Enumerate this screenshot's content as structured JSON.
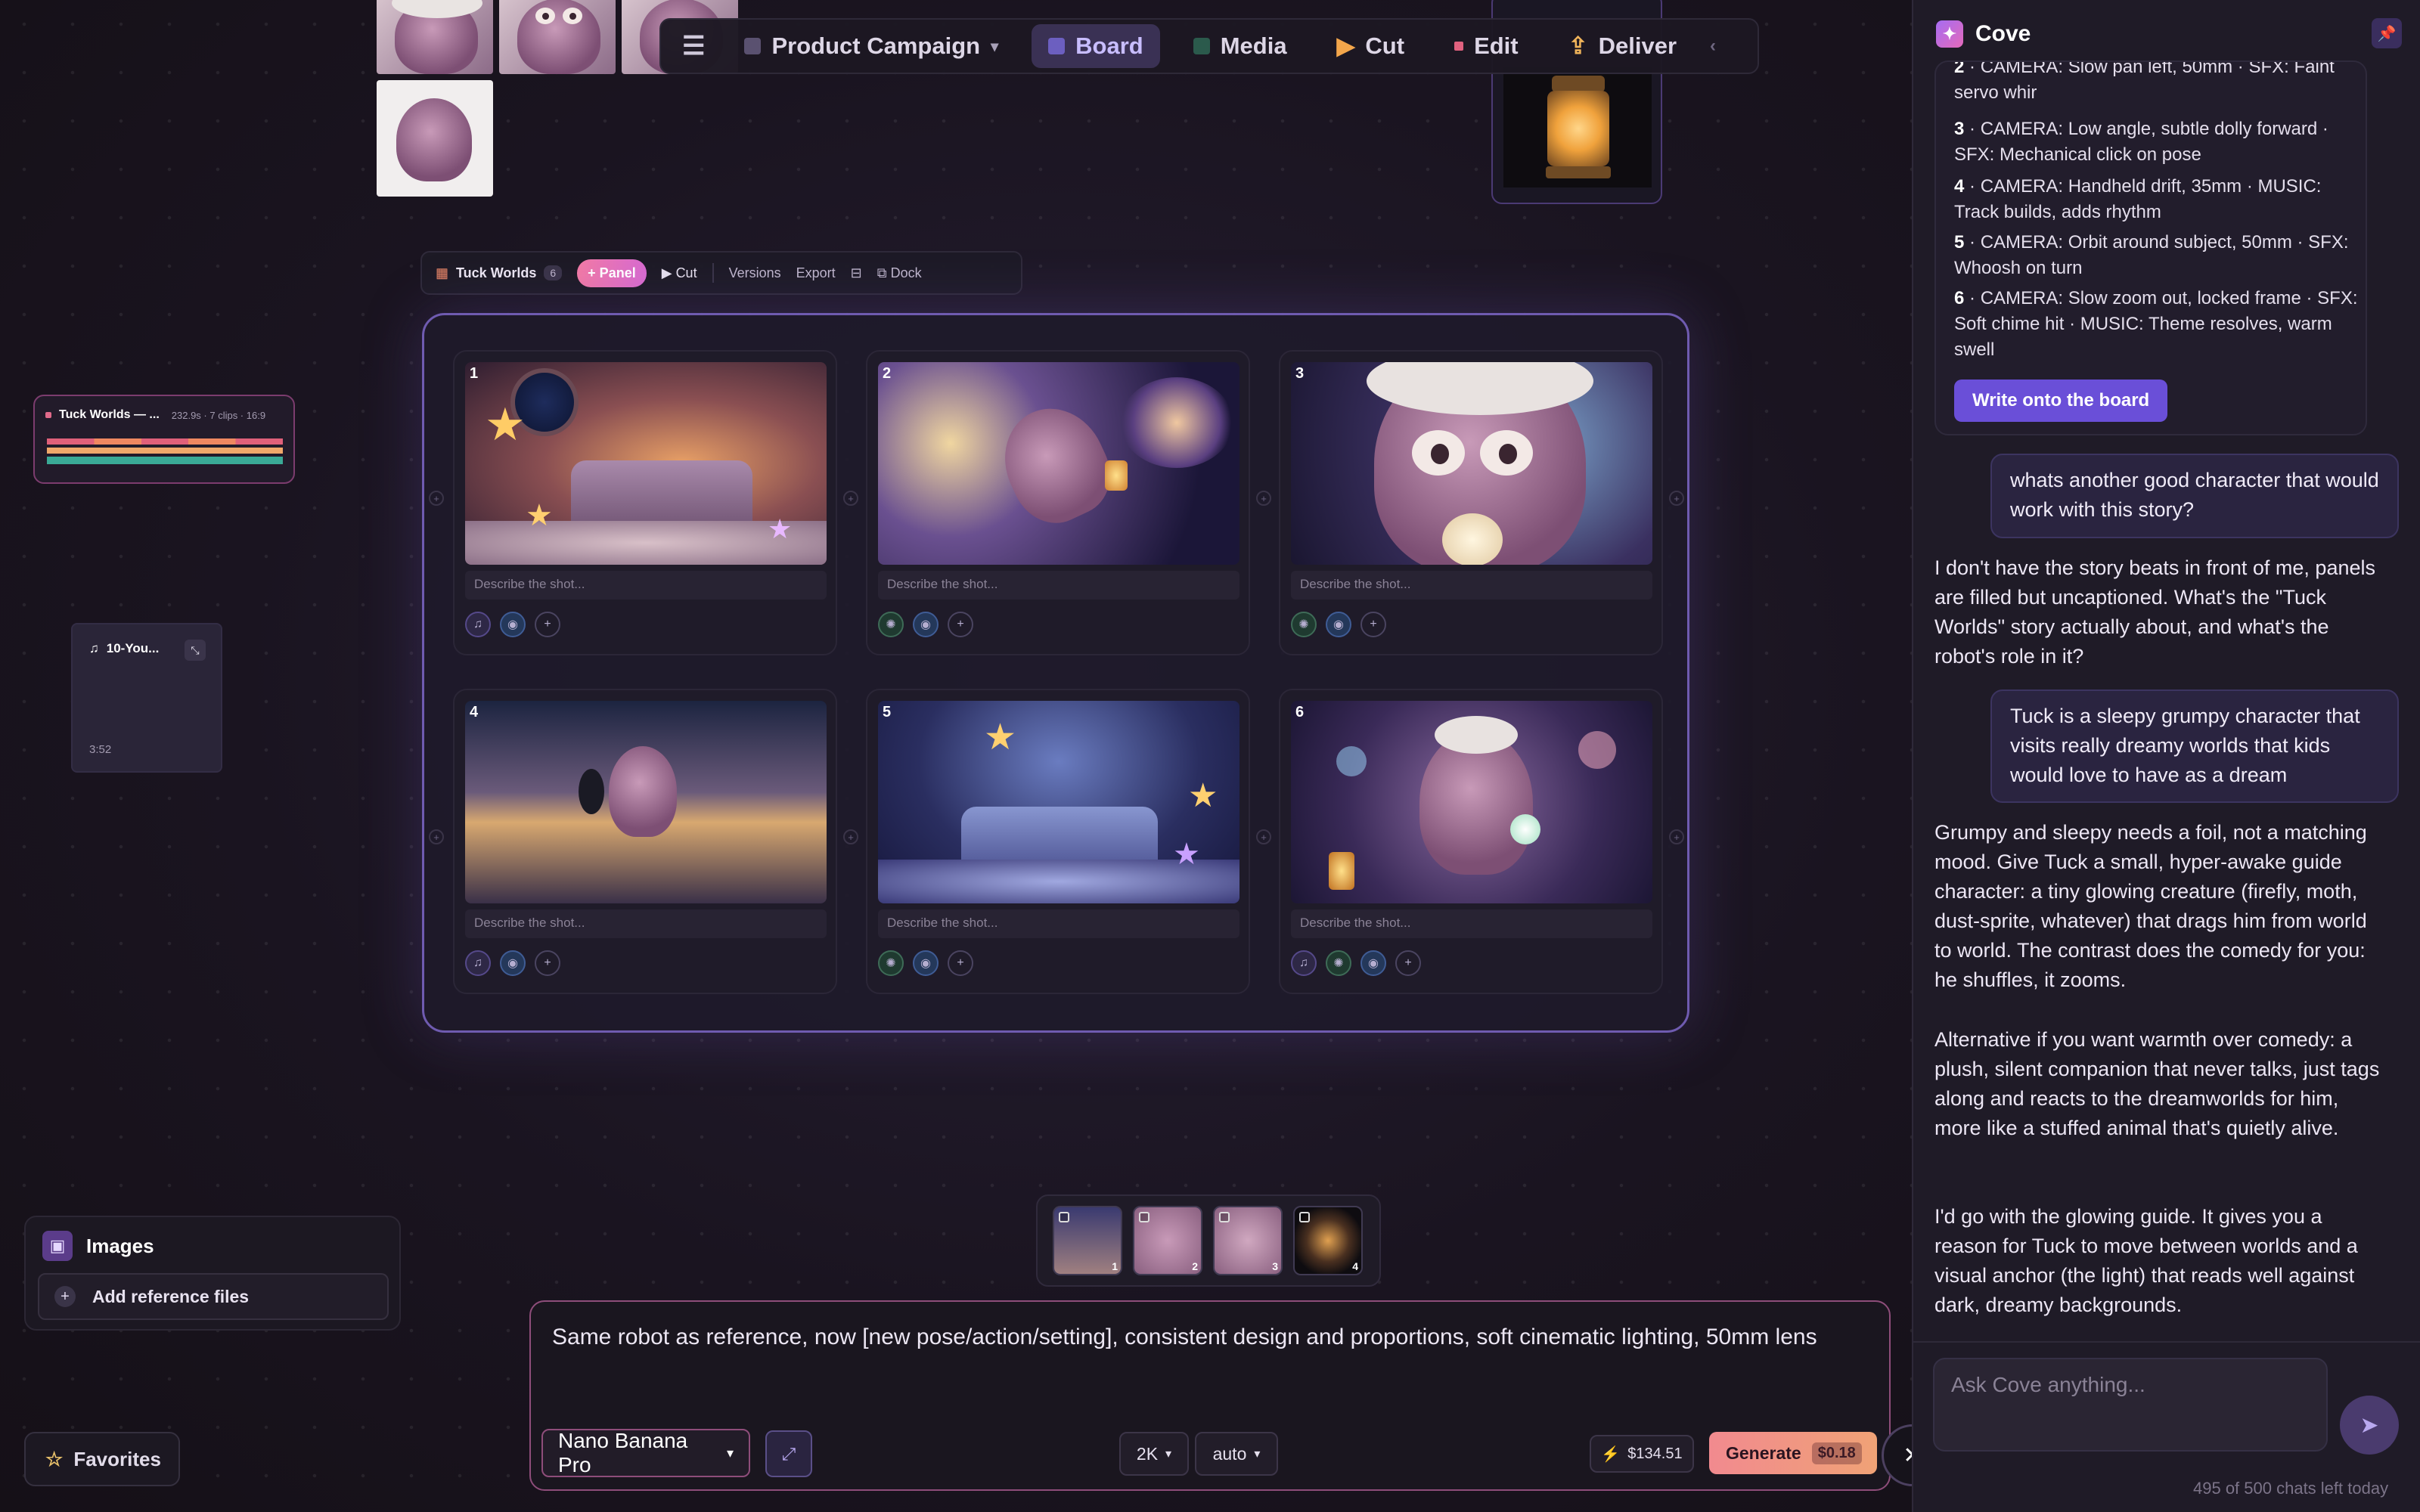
{
  "topnav": {
    "project": "Product Campaign",
    "items": [
      {
        "label": "Board",
        "active": true
      },
      {
        "label": "Media"
      },
      {
        "label": "Cut"
      },
      {
        "label": "Edit"
      },
      {
        "label": "Deliver"
      }
    ]
  },
  "board_toolbar": {
    "name": "Tuck Worlds",
    "count": "6",
    "add_panel": "+ Panel",
    "cut": "▶ Cut",
    "versions": "Versions",
    "export": "Export",
    "dock": "Dock"
  },
  "panels": [
    {
      "num": "1",
      "placeholder": "Describe the shot..."
    },
    {
      "num": "2",
      "placeholder": "Describe the shot..."
    },
    {
      "num": "3",
      "placeholder": "Describe the shot..."
    },
    {
      "num": "4",
      "placeholder": "Describe the shot..."
    },
    {
      "num": "5",
      "placeholder": "Describe the shot..."
    },
    {
      "num": "6",
      "placeholder": "Describe the shot..."
    }
  ],
  "timeline_card": {
    "title": "Tuck Worlds — ...",
    "meta": "232.9s · 7 clips · 16:9"
  },
  "audio_card": {
    "title": "10-You...",
    "duration": "3:52"
  },
  "images_panel": {
    "title": "Images",
    "add": "Add reference files"
  },
  "favorites": "Favorites",
  "strip_nums": [
    "1",
    "2",
    "3",
    "4"
  ],
  "prompt": {
    "text": "Same robot as reference, now [new pose/action/setting], consistent design and proportions, soft cinematic lighting, 50mm lens",
    "model": "Nano Banana Pro",
    "resolution": "2K",
    "aspect": "auto",
    "balance": "$134.51",
    "generate": "Generate",
    "price": "$0.18"
  },
  "cove": {
    "title": "Cove",
    "shots": [
      {
        "n": "2",
        "text": " · CAMERA: Slow pan left, 50mm · SFX: Faint servo whir"
      },
      {
        "n": "3",
        "text": " · CAMERA: Low angle, subtle dolly forward · SFX: Mechanical click on pose"
      },
      {
        "n": "4",
        "text": " · CAMERA: Handheld drift, 35mm · MUSIC: Track builds, adds rhythm"
      },
      {
        "n": "5",
        "text": " · CAMERA: Orbit around subject, 50mm · SFX: Whoosh on turn"
      },
      {
        "n": "6",
        "text": " · CAMERA: Slow zoom out, locked frame · SFX: Soft chime hit · MUSIC: Theme resolves, warm swell"
      }
    ],
    "write_button": "Write onto the board",
    "user1": "whats another good character that would work with this story?",
    "ai1": "I don't have the story beats in front of me, panels are filled but uncaptioned. What's the \"Tuck Worlds\" story actually about, and what's the robot's role in it?",
    "user2": "Tuck is a sleepy grumpy character that visits really dreamy worlds that kids would love to have as a dream",
    "ai2a": "Grumpy and sleepy needs a foil, not a matching mood. Give Tuck a small, hyper-awake guide character: a tiny glowing creature (firefly, moth, dust-sprite, whatever) that drags him from world to world. The contrast does the comedy for you: he shuffles, it zooms.",
    "ai2b": "Alternative if you want warmth over comedy: a plush, silent companion that never talks, just tags along and reacts to the dreamworlds for him, more like a stuffed animal that's quietly alive.",
    "ai2c": "I'd go with the glowing guide. It gives you a reason for Tuck to move between worlds and a visual anchor (the light) that reads well against dark, dreamy backgrounds.",
    "ask_placeholder": "Ask Cove anything...",
    "quota": "495 of 500 chats left today"
  }
}
